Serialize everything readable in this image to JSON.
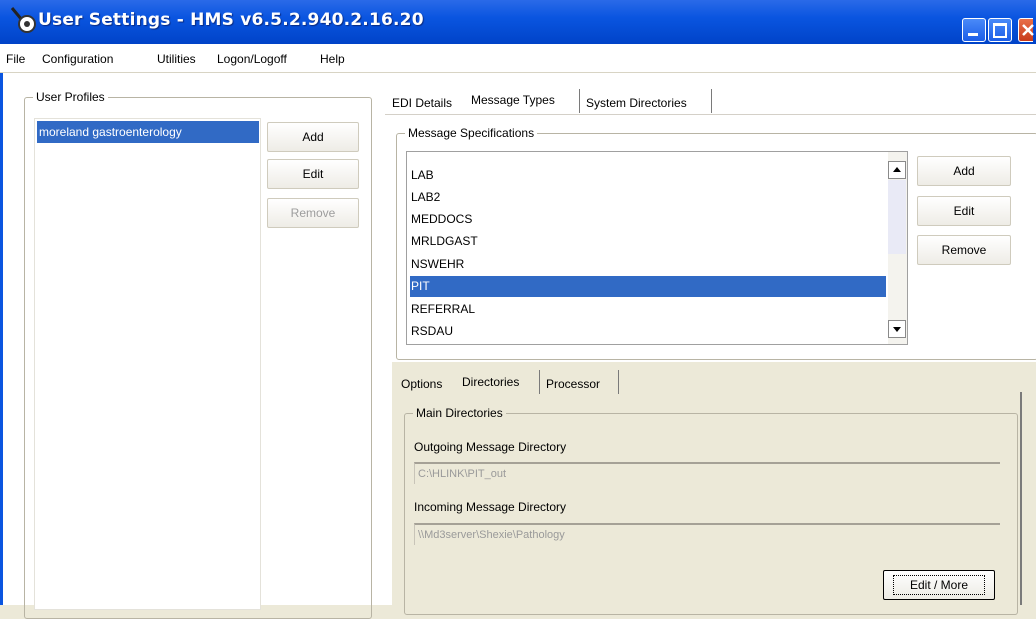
{
  "window": {
    "title": "User Settings - HMS v6.5.2.940.2.16.20"
  },
  "menu": [
    "File",
    "Configuration",
    "Utilities",
    "Logon/Logoff",
    "Help"
  ],
  "user_profiles": {
    "label": "User Profiles",
    "items": [
      "moreland gastroenterology"
    ],
    "selected_index": 0,
    "buttons": {
      "add": "Add",
      "edit": "Edit",
      "remove": "Remove"
    }
  },
  "top_tabs": [
    "EDI Details",
    "Message Types",
    "System Directories"
  ],
  "top_tabs_active": "Message Types",
  "message_specs": {
    "label": "Message Specifications",
    "items": [
      "LAB",
      "LAB2",
      "MEDDOCS",
      "MRLDGAST",
      "NSWEHR",
      "PIT",
      "REFERRAL",
      "RSDAU"
    ],
    "selected": "PIT",
    "buttons": {
      "add": "Add",
      "edit": "Edit",
      "remove": "Remove"
    }
  },
  "sub_tabs": [
    "Options",
    "Directories",
    "Processor"
  ],
  "sub_tabs_active": "Directories",
  "main_directories": {
    "label": "Main Directories",
    "outgoing_label": "Outgoing Message Directory",
    "outgoing_value": "C:\\HLINK\\PIT_out",
    "incoming_label": "Incoming Message Directory",
    "incoming_value": "\\\\Md3server\\Shexie\\Pathology",
    "edit_more": "Edit / More"
  }
}
